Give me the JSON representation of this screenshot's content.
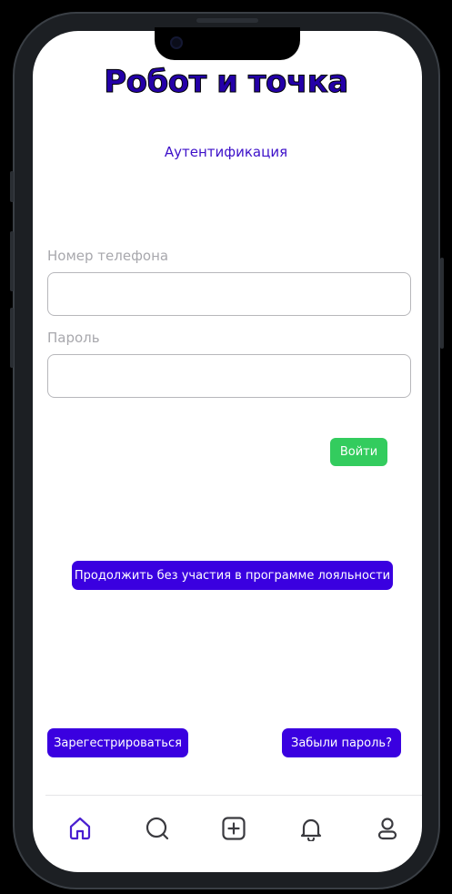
{
  "app": {
    "title": "Робот и точка",
    "subtitle": "Аутентификация"
  },
  "form": {
    "phone_label": "Номер телефона",
    "phone_value": "",
    "password_label": "Пароль",
    "password_value": "",
    "login_button": "Войти"
  },
  "actions": {
    "continue_without_loyalty": "Продолжить без участия в программе лояльности",
    "register": "Зарегестрироваться",
    "forgot_password": "Забыли пароль?"
  },
  "bottom_nav": {
    "items": [
      {
        "icon": "home-icon",
        "active": true
      },
      {
        "icon": "search-icon",
        "active": false
      },
      {
        "icon": "add-icon",
        "active": false
      },
      {
        "icon": "bell-icon",
        "active": false
      },
      {
        "icon": "profile-icon",
        "active": false
      }
    ]
  },
  "colors": {
    "accent": "#3a00e0",
    "success": "#33cc5e",
    "nav_active": "#4a1fd0",
    "nav_inactive": "#3a3a3f"
  }
}
